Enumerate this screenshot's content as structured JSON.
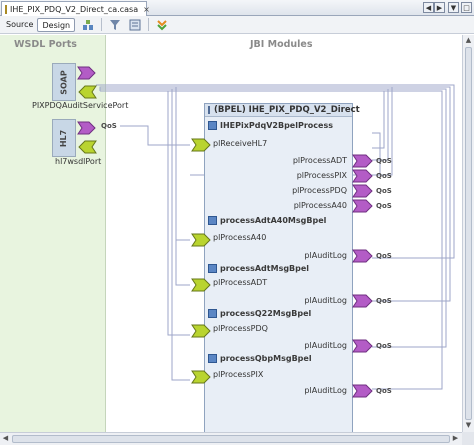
{
  "tab": {
    "title": "IHE_PIX_PDQ_V2_Direct_ca.casa",
    "close": "×"
  },
  "toolbar": {
    "source_label": "Source",
    "design_label": "Design"
  },
  "nav": {
    "left": "◀",
    "right": "▶",
    "menu": "▼",
    "max": "□"
  },
  "panes": {
    "wsdl_title": "WSDL Ports",
    "jbi_title": "JBI Modules"
  },
  "wsdl_ports": [
    {
      "type": "SOAP",
      "name": "PIXPDQAuditServicePort"
    },
    {
      "type": "HL7",
      "name": "hl7wsdlPort",
      "qos": "QoS"
    }
  ],
  "module": {
    "title": "(BPEL) IHE_PIX_PDQ_V2_Direct",
    "processes": [
      {
        "name": "IHEPixPdqV2BpelProcess",
        "consumer": "plReceiveHL7",
        "providers": [
          "plProcessADT",
          "plProcessPIX",
          "plProcessPDQ",
          "plProcessA40"
        ]
      },
      {
        "name": "processAdtA40MsgBpel",
        "consumer": "plProcessA40",
        "providers": [
          "plAuditLog"
        ]
      },
      {
        "name": "processAdtMsgBpel",
        "consumer": "plProcessADT",
        "providers": [
          "plAuditLog"
        ]
      },
      {
        "name": "processQ22MsgBpel",
        "consumer": "plProcessPDQ",
        "providers": [
          "plAuditLog"
        ]
      },
      {
        "name": "processQbpMsgBpel",
        "consumer": "plProcessPIX",
        "providers": [
          "plAuditLog"
        ]
      }
    ],
    "qos": "QoS"
  },
  "colors": {
    "wsdl_bg": "#e8f4df",
    "module_bg": "#e8eef6",
    "provider_arrow": "#b35cc6",
    "consumer_arrow": "#b9d42f"
  }
}
